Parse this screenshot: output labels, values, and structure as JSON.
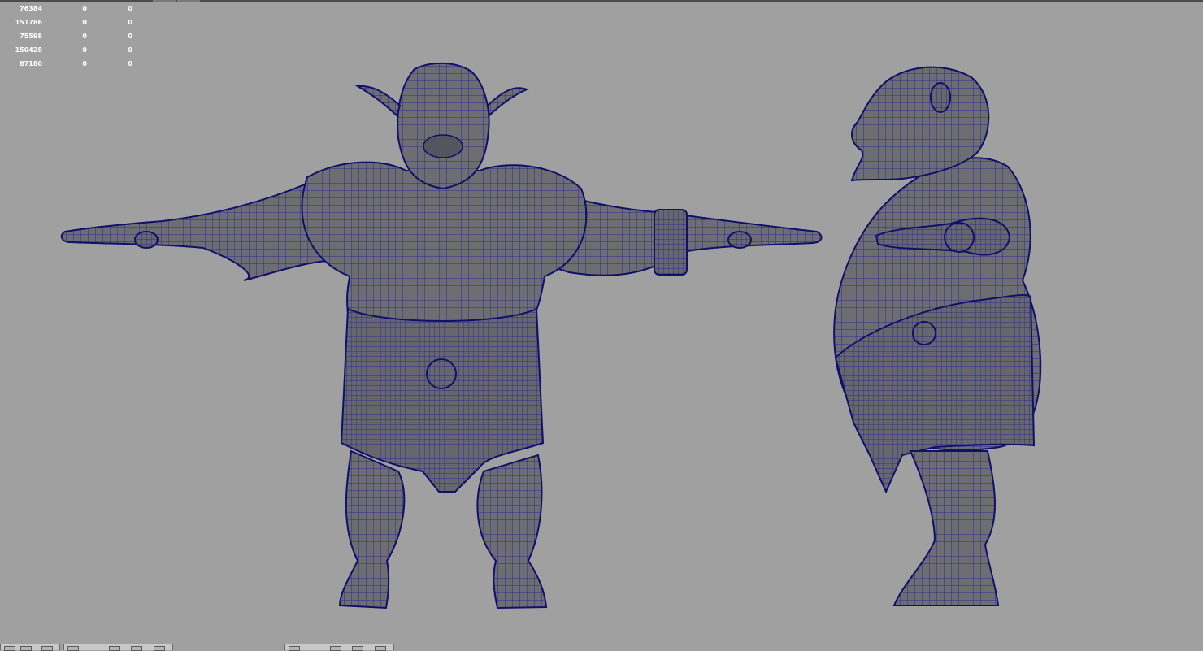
{
  "hud": {
    "rows": [
      [
        "76384",
        "0",
        "0"
      ],
      [
        "151786",
        "0",
        "0"
      ],
      [
        "75598",
        "0",
        "0"
      ],
      [
        "150428",
        "0",
        "0"
      ],
      [
        "87180",
        "0",
        "0"
      ]
    ]
  },
  "viewport": {
    "background": "#a0a0a0",
    "mesh_fill": "#6d6d70",
    "wireframe_color": "#1c1c9c",
    "models": [
      "ogre-front-view",
      "ogre-side-view"
    ]
  }
}
